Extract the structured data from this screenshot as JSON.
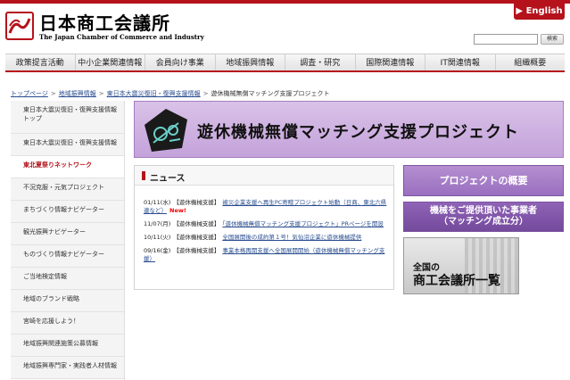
{
  "header": {
    "org_name": "日本商工会議所",
    "org_name_en": "The Japan Chamber of Commerce and Industry",
    "english_link": "▶ English",
    "search_placeholder": "",
    "search_button": "検索"
  },
  "nav": [
    "政策提言活動",
    "中小企業関連情報",
    "会員向け事業",
    "地域振興情報",
    "調査・研究",
    "国際関連情報",
    "IT関連情報",
    "組織概要"
  ],
  "breadcrumb": [
    "トップページ",
    "地域振興情報",
    "東日本大震災復旧・復興支援情報",
    "遊休機械無償マッチング支援プロジェクト"
  ],
  "sidebar": {
    "items": [
      "東日本大震災復旧・復興支援情報 トップ",
      "東日本大震災復旧・復興支援情報",
      "東北夏祭りネットワーク",
      "不況克服・元気プロジェクト",
      "まちづくり情報ナビゲーター",
      "観光振興ナビゲーター",
      "ものづくり情報ナビゲーター",
      "ご当地検定情報",
      "地域のブランド戦略",
      "宮崎を応援しよう！",
      "地域振興関連施策公募情報",
      "地域振興専門家・実践者人材情報"
    ],
    "active_index": 2
  },
  "banner": {
    "title": "遊休機械無償マッチング支援プロジェクト"
  },
  "news": {
    "title": "ニュース",
    "items": [
      {
        "date": "01/11(水)",
        "tag": "【遊休機械支援】",
        "text": "被災企業支援へ再生PC寄贈プロジェクト始動（日商、東北六県連など）",
        "new": "New!"
      },
      {
        "date": "11/07(月)",
        "tag": "【遊休機械支援】",
        "text": "「遊休機械無償マッチング支援プロジェクト」PRページを開設",
        "new": ""
      },
      {
        "date": "10/11(火)",
        "tag": "【遊休機械支援】",
        "text": "全国展開後の成約第１号！気仙沼企業に遊休機械提供",
        "new": ""
      },
      {
        "date": "09/16(金)",
        "tag": "【遊休機械支援】",
        "text": "事業本格再開支援へ全国展開開始（遊休機械無償マッチング支援）",
        "new": ""
      }
    ]
  },
  "right": {
    "overview_button": "プロジェクトの概要",
    "providers_line1": "機械をご提供頂いた事業者",
    "providers_line2": "（マッチング成立分）",
    "cci_list_line1": "全国の",
    "cci_list_line2": "商工会議所一覧"
  },
  "colors": {
    "brand_red": "#b5121b",
    "banner_purple": "#c4a2da",
    "button_purple": "#744a9c"
  }
}
